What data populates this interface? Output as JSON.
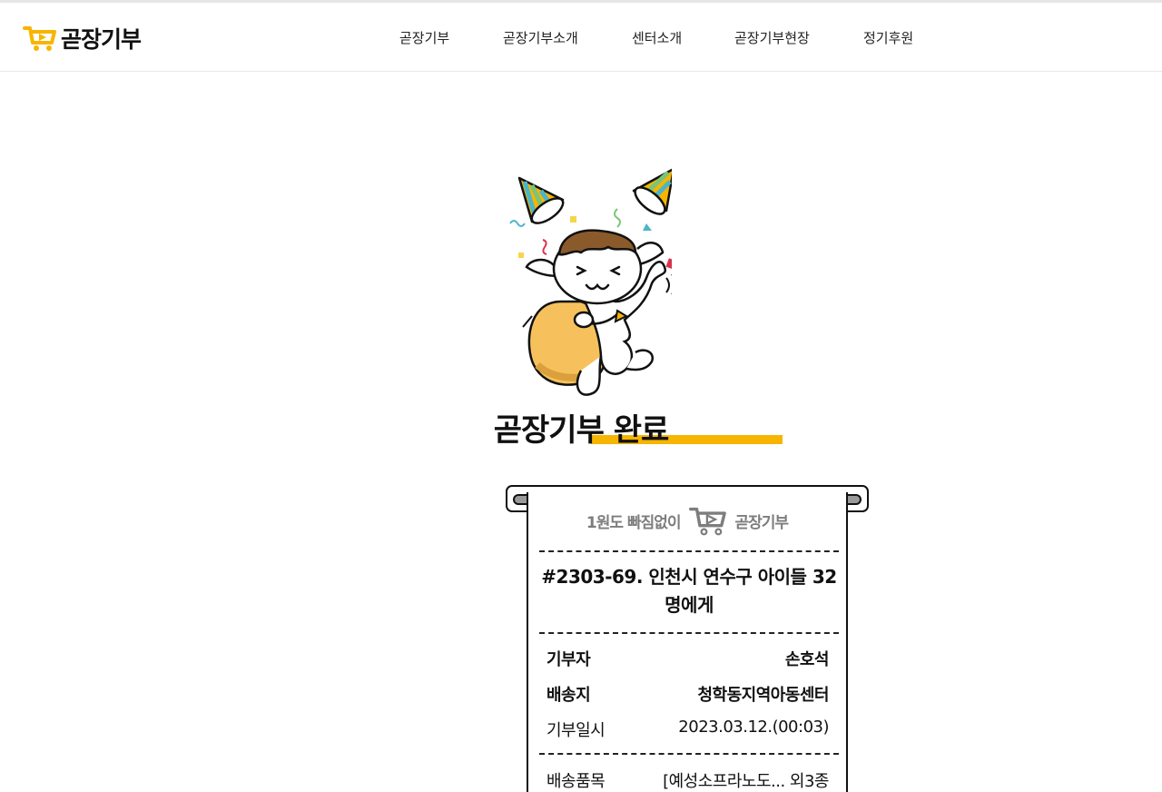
{
  "header": {
    "logo_text": "곧장기부",
    "logo_icon": "cart-play-icon",
    "nav": [
      "곧장기부",
      "곧장기부소개",
      "센터소개",
      "곧장기부현장",
      "정기후원"
    ]
  },
  "main": {
    "illustration": "celebrating-goat-illustration",
    "title": "곧장기부 완료"
  },
  "receipt": {
    "slogan": "1원도 빠짐없이",
    "brand": "곧장기부",
    "project_title": "#2303-69. 인천시 연수구 아이들 32명에게",
    "rows": [
      {
        "label": "기부자",
        "value": "손호석"
      },
      {
        "label": "배송지",
        "value": "청학동지역아동센터"
      },
      {
        "label": "기부일시",
        "value": "2023.03.12.(00:03)"
      },
      {
        "label": "배송품목",
        "value": "[예성소프라노도... 외3종"
      }
    ]
  },
  "colors": {
    "accent": "#f7b500",
    "bag": "#f6c15c",
    "text": "#111111",
    "muted": "#7d7d7d"
  }
}
